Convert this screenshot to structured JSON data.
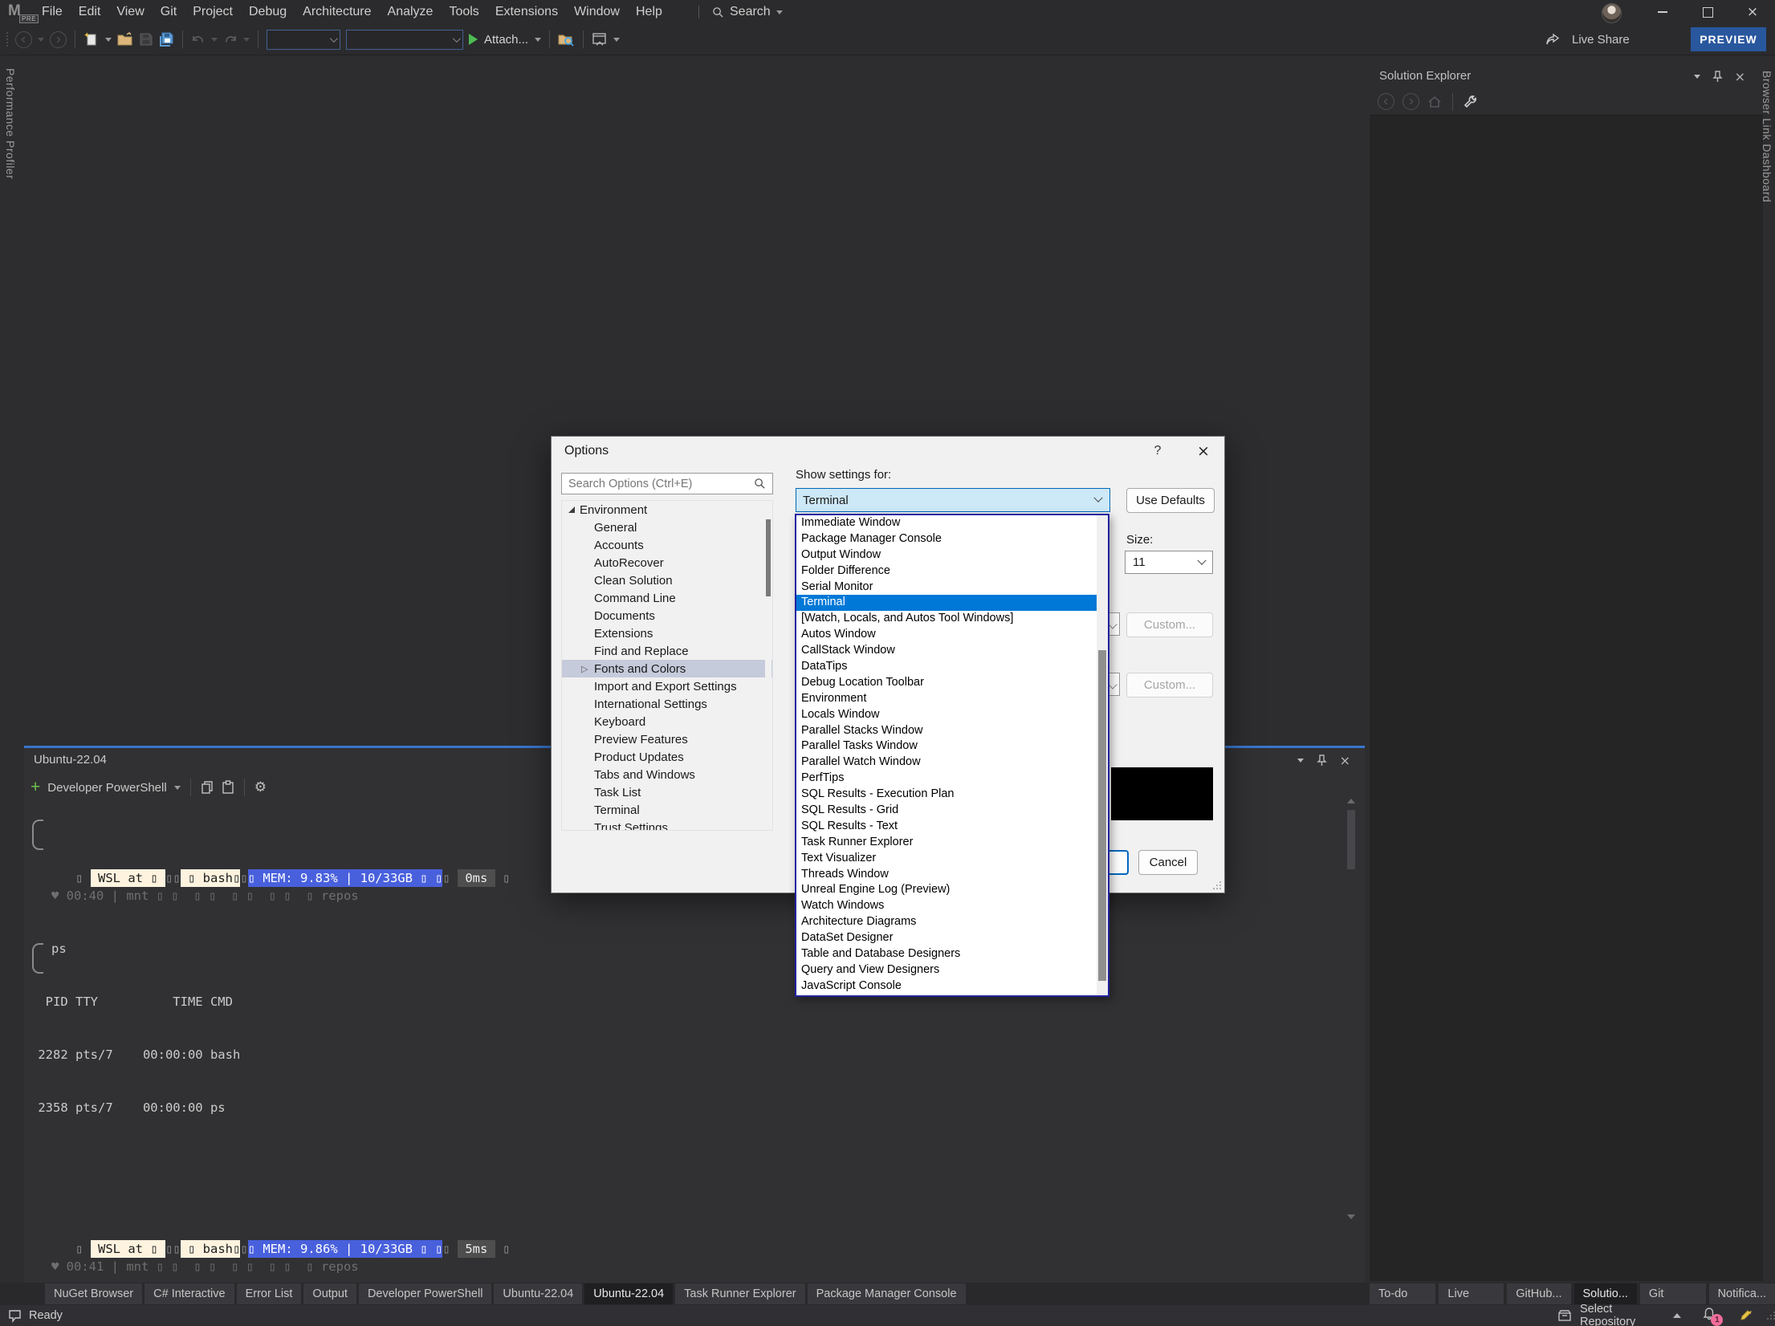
{
  "colors": {
    "accent_blue": "#0078d7",
    "focus_border_blue": "#3874cc",
    "preview_badge_blue": "#29579e",
    "combo_focus_fill": "#cde8f6",
    "prompt_cream": "#fdf3df",
    "prompt_blue": "#4960dd",
    "prompt_gray": "#4e4e4e",
    "notification_badge_pink": "#f06d98"
  },
  "titlebar": {
    "logo_badge": "PRE",
    "menus": [
      "File",
      "Edit",
      "View",
      "Git",
      "Project",
      "Debug",
      "Architecture",
      "Analyze",
      "Tools",
      "Extensions",
      "Window",
      "Help"
    ],
    "search_label": "Search",
    "live_share": "Live Share",
    "preview_badge": "PREVIEW"
  },
  "toolbar": {
    "attach_label": "Attach..."
  },
  "edges": {
    "left_tab": "Performance Profiler",
    "right_tab": "Browser Link Dashboard"
  },
  "solution_explorer": {
    "title": "Solution Explorer"
  },
  "dialog": {
    "title": "Options",
    "help_glyph": "?",
    "search_placeholder": "Search Options (Ctrl+E)",
    "tree_root": "Environment",
    "tree_items": [
      {
        "label": "General"
      },
      {
        "label": "Accounts"
      },
      {
        "label": "AutoRecover"
      },
      {
        "label": "Clean Solution"
      },
      {
        "label": "Command Line"
      },
      {
        "label": "Documents"
      },
      {
        "label": "Extensions"
      },
      {
        "label": "Find and Replace"
      },
      {
        "label": "Fonts and Colors",
        "cls": "selected has-expander"
      },
      {
        "label": "Import and Export Settings"
      },
      {
        "label": "International Settings"
      },
      {
        "label": "Keyboard"
      },
      {
        "label": "Preview Features"
      },
      {
        "label": "Product Updates"
      },
      {
        "label": "Tabs and Windows"
      },
      {
        "label": "Task List"
      },
      {
        "label": "Terminal"
      },
      {
        "label": "Trust Settings"
      }
    ],
    "show_settings_label": "Show settings for:",
    "show_settings_value": "Terminal",
    "use_defaults": "Use Defaults",
    "size_label": "Size:",
    "size_value": "11",
    "custom_button": "Custom...",
    "cancel": "Cancel",
    "dropdown_items": [
      {
        "label": "Immediate Window"
      },
      {
        "label": "Package Manager Console"
      },
      {
        "label": "Output Window"
      },
      {
        "label": "Folder Difference"
      },
      {
        "label": "Serial Monitor"
      },
      {
        "label": "Terminal",
        "cls": "selected"
      },
      {
        "label": "[Watch, Locals, and Autos Tool Windows]"
      },
      {
        "label": "Autos Window"
      },
      {
        "label": "CallStack Window"
      },
      {
        "label": "DataTips"
      },
      {
        "label": "Debug Location Toolbar"
      },
      {
        "label": "Environment"
      },
      {
        "label": "Locals Window"
      },
      {
        "label": "Parallel Stacks Window"
      },
      {
        "label": "Parallel Tasks Window"
      },
      {
        "label": "Parallel Watch Window"
      },
      {
        "label": "PerfTips"
      },
      {
        "label": "SQL Results - Execution Plan"
      },
      {
        "label": "SQL Results - Grid"
      },
      {
        "label": "SQL Results - Text"
      },
      {
        "label": "Task Runner Explorer"
      },
      {
        "label": "Text Visualizer"
      },
      {
        "label": "Threads Window"
      },
      {
        "label": "Unreal Engine Log (Preview)"
      },
      {
        "label": "Watch Windows"
      },
      {
        "label": "Architecture Diagrams"
      },
      {
        "label": "DataSet Designer"
      },
      {
        "label": "Table and Database Designers"
      },
      {
        "label": "Query and View Designers"
      },
      {
        "label": "JavaScript Console"
      }
    ]
  },
  "terminal": {
    "panel_title": "Ubuntu-22.04",
    "shell_selector": "Developer PowerShell",
    "prompt1": [
      {
        "t": "▯ ",
        "cls": "t-plain"
      },
      {
        "t": " WSL at ▯ ",
        "cls": "t-cream"
      },
      {
        "t": "▯▯",
        "cls": "t-plain"
      },
      {
        "t": " ▯ bash▯",
        "cls": "t-cream"
      },
      {
        "t": "▯",
        "cls": "t-plain"
      },
      {
        "t": "▯ MEM: 9.83% | 10/33GB ▯ ▯",
        "cls": "t-blue"
      },
      {
        "t": "▯ ",
        "cls": "t-plain"
      },
      {
        "t": " 0ms ",
        "cls": "t-gray"
      },
      {
        "t": " ▯",
        "cls": "t-plain"
      }
    ],
    "line_time1": "♥ 00:40 | mnt ▯ ▯  ▯ ▯  ▯ ▯  ▯ ▯  ▯ repos",
    "cmd1": "ps",
    "ps_header": "  PID TTY          TIME CMD",
    "ps_row1": " 2282 pts/7    00:00:00 bash",
    "ps_row2": " 2358 pts/7    00:00:00 ps",
    "prompt2": [
      {
        "t": "▯ ",
        "cls": "t-plain"
      },
      {
        "t": " WSL at ▯ ",
        "cls": "t-cream"
      },
      {
        "t": "▯▯",
        "cls": "t-plain"
      },
      {
        "t": " ▯ bash▯",
        "cls": "t-cream"
      },
      {
        "t": "▯",
        "cls": "t-plain"
      },
      {
        "t": "▯ MEM: 9.86% | 10/33GB ▯ ▯",
        "cls": "t-blue"
      },
      {
        "t": "▯ ",
        "cls": "t-plain"
      },
      {
        "t": " 5ms ",
        "cls": "t-gray"
      },
      {
        "t": " ▯",
        "cls": "t-plain"
      }
    ],
    "line_time2": "♥ 00:41 | mnt ▯ ▯  ▯ ▯  ▯ ▯  ▯ ▯  ▯ repos"
  },
  "bottom": {
    "tabs_left": [
      {
        "label": "NuGet Browser"
      },
      {
        "label": "C# Interactive"
      },
      {
        "label": "Error List"
      },
      {
        "label": "Output"
      },
      {
        "label": "Developer PowerShell"
      },
      {
        "label": "Ubuntu-22.04"
      },
      {
        "label": "Ubuntu-22.04",
        "cls": "active"
      },
      {
        "label": "Task Runner Explorer"
      },
      {
        "label": "Package Manager Console"
      }
    ],
    "tabs_right": [
      {
        "label": "To-do E..."
      },
      {
        "label": "Live Sh..."
      },
      {
        "label": "GitHub..."
      },
      {
        "label": "Solutio...",
        "cls": "active"
      },
      {
        "label": "Git Cha..."
      },
      {
        "label": "Notifica..."
      }
    ]
  },
  "statusbar": {
    "ready": "Ready",
    "select_repository": "Select Repository",
    "notification_count": "1"
  }
}
